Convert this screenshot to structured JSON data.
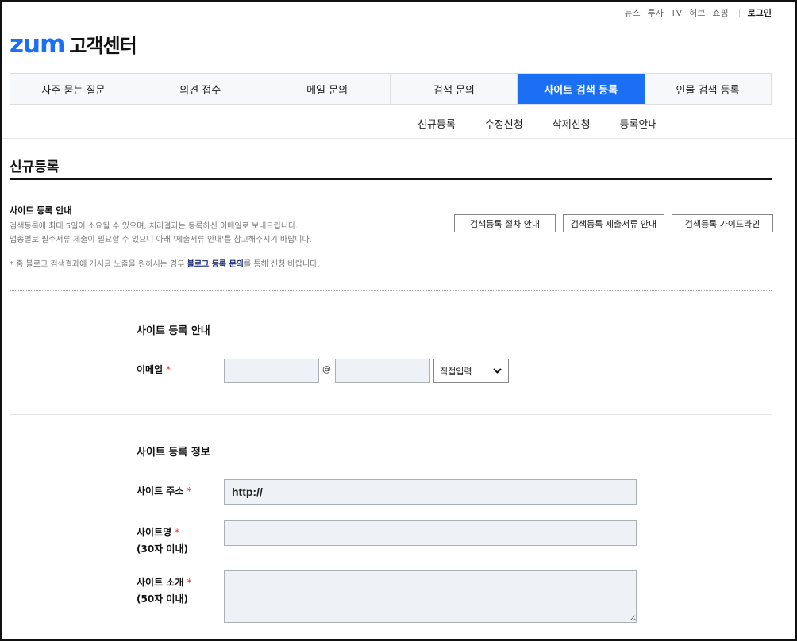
{
  "topnav": {
    "links": [
      "뉴스",
      "투자",
      "TV",
      "허브",
      "쇼핑"
    ],
    "login": "로그인"
  },
  "logo": {
    "brand": "zum",
    "sub": "고객센터"
  },
  "tabs": [
    {
      "label": "자주 묻는 질문"
    },
    {
      "label": "의견 접수"
    },
    {
      "label": "메일 문의"
    },
    {
      "label": "검색 문의"
    },
    {
      "label": "사이트 검색 등록",
      "active": true
    },
    {
      "label": "인물 검색 등록"
    }
  ],
  "subtabs": [
    "신규등록",
    "수정신청",
    "삭제신청",
    "등록안내"
  ],
  "page": {
    "title": "신규등록"
  },
  "guide": {
    "title": "사이트 등록 안내",
    "line1": "검색등록에 최대 5일이 소요될 수 있으며, 처리결과는 등록하신 이메일로 보내드립니다.",
    "line2": "업종별로 필수서류 제출이 필요할 수 있으니 아래 '제출서류 안내'를 참고해주시기 바랍니다.",
    "note_prefix": "* 줌 블로그 검색결과에 게시글 노출을 원하시는 경우 ",
    "note_link": "블로그 등록 문의",
    "note_suffix": "를 통해 신청 바랍니다."
  },
  "buttons": {
    "process": "검색등록 절차 안내",
    "documents": "검색등록 제출서류 안내",
    "guideline": "검색등록 가이드라인"
  },
  "section1": {
    "title": "사이트 등록 안내",
    "email_label": "이메일",
    "required_mark": "*",
    "at": "@",
    "email_user": "",
    "email_domain": "",
    "domain_select": "직접입력"
  },
  "section2": {
    "title": "사이트 등록 정보",
    "url_label": "사이트 주소",
    "url_value": "http://",
    "name_label": "사이트명",
    "name_hint": "(30자 이내)",
    "intro_label": "사이트 소개",
    "intro_hint": "(50자 이내)",
    "required_mark": "*"
  },
  "colors": {
    "accent": "#1b6ff5",
    "required": "#e23b3b",
    "input_bg": "#eef1f5"
  }
}
